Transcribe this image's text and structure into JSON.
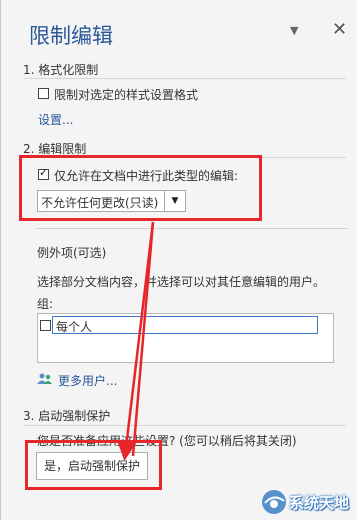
{
  "pane": {
    "title": "限制编辑",
    "menu_icon": "chevron-down-icon",
    "close_icon": "close-icon"
  },
  "section1": {
    "heading": "1. 格式化限制",
    "checkbox_label": "限制对选定的样式设置格式",
    "checked": false,
    "settings_link": "设置..."
  },
  "section2": {
    "heading": "2. 编辑限制",
    "checkbox_label": "仅允许在文档中进行此类型的编辑:",
    "checked": true,
    "dropdown_value": "不允许任何更改(只读)",
    "exceptions_heading": "例外项(可选)",
    "exceptions_desc": "选择部分文档内容，并选择可以对其任意编辑的用户。",
    "groups_label": "组:",
    "groups": [
      {
        "label": "每个人",
        "checked": false
      }
    ],
    "more_users_link": "更多用户..."
  },
  "section3": {
    "heading": "3. 启动强制保护",
    "question": "您是否准备应用这些设置? (您可以稍后将其关闭)",
    "start_button": "是，启动强制保护"
  },
  "annotation": {
    "color": "#e6262a"
  },
  "watermark": {
    "text": "系统天地"
  }
}
